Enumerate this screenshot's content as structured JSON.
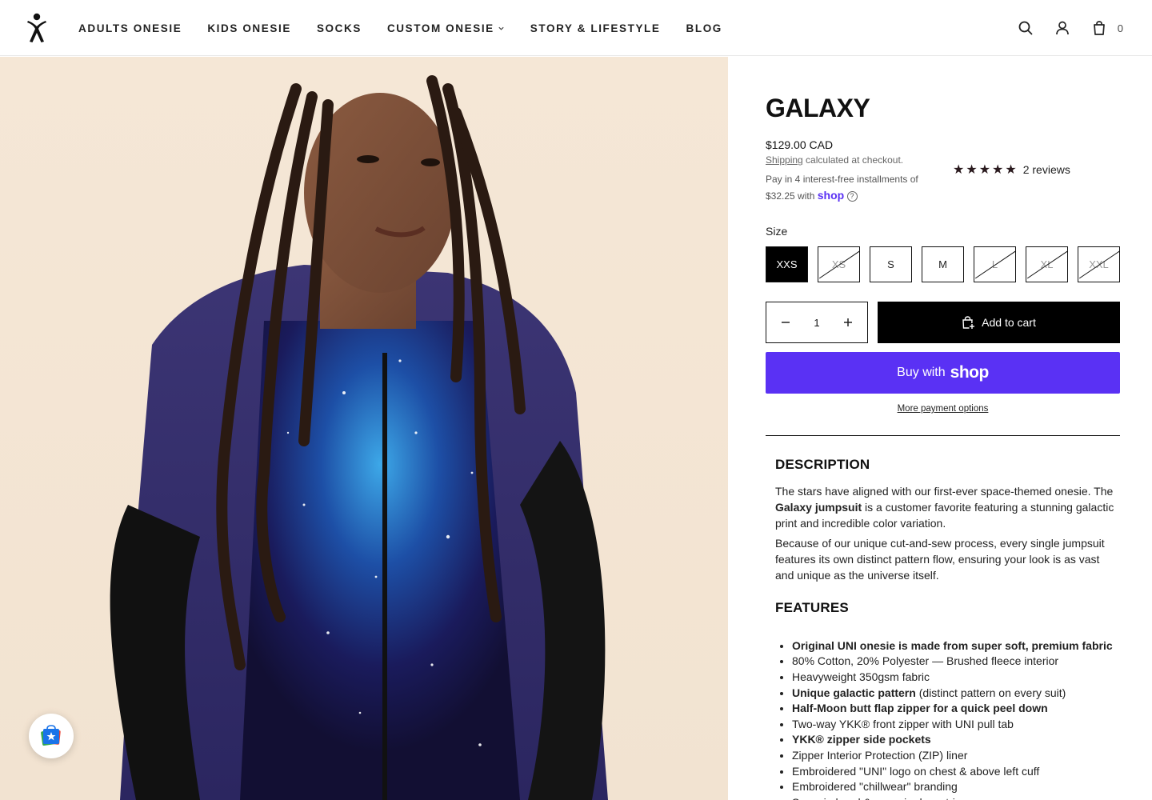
{
  "brand": {
    "logo_icon": "stick-figure-logo-icon"
  },
  "nav": {
    "items": [
      {
        "label": "ADULTS ONESIE"
      },
      {
        "label": "KIDS ONESIE"
      },
      {
        "label": "SOCKS"
      },
      {
        "label": "CUSTOM ONESIE",
        "has_dropdown": true
      },
      {
        "label": "STORY & LIFESTYLE"
      },
      {
        "label": "BLOG"
      }
    ]
  },
  "header": {
    "cart_count": "0",
    "icons": [
      "search-icon",
      "account-icon",
      "cart-icon"
    ]
  },
  "product": {
    "title": "GALAXY",
    "price": "$129.00 CAD",
    "shipping_link": "Shipping",
    "shipping_rest": " calculated at checkout.",
    "installments_text": "Pay in 4 interest-free installments of",
    "installments_amount": "$32.25",
    "installments_with": "with",
    "shop_word": "shop",
    "rating_stars": 5,
    "reviews_label": "2 reviews",
    "size_label": "Size",
    "sizes": [
      {
        "label": "XXS",
        "state": "selected"
      },
      {
        "label": "XS",
        "state": "soldout"
      },
      {
        "label": "S",
        "state": "available"
      },
      {
        "label": "M",
        "state": "available"
      },
      {
        "label": "L",
        "state": "soldout"
      },
      {
        "label": "XL",
        "state": "soldout"
      },
      {
        "label": "XXL",
        "state": "soldout"
      }
    ],
    "quantity": "1",
    "add_to_cart": "Add to cart",
    "buy_with": "Buy with",
    "buy_shop": "shop",
    "more_payment": "More payment options"
  },
  "description": {
    "title": "DESCRIPTION",
    "p1_a": "The stars have aligned with our first-ever space-themed onesie. The ",
    "p1_bold": "Galaxy jumpsuit",
    "p1_b": " is a customer favorite featuring a stunning galactic print and incredible color variation.",
    "p2": "Because of our unique cut-and-sew process, every single jumpsuit features its own distinct pattern flow, ensuring your look is as vast and unique as the universe itself.",
    "features_title": "FEATURES",
    "features": [
      {
        "bold": "Original UNI onesie is made from super soft, premium fabric",
        "rest": ""
      },
      {
        "bold": "",
        "rest": "80% Cotton, 20% Polyester — Brushed fleece interior"
      },
      {
        "bold": "",
        "rest": "Heavyweight 350gsm fabric"
      },
      {
        "bold": "Unique galactic pattern",
        "rest": " (distinct pattern on every suit)"
      },
      {
        "bold": "Half-Moon butt flap zipper for a quick peel down",
        "rest": ""
      },
      {
        "bold": "",
        "rest": "Two-way YKK® front zipper with UNI pull tab"
      },
      {
        "bold": "YKK® zipper side pockets",
        "rest": ""
      },
      {
        "bold": "",
        "rest": "Zipper Interior Protection (ZIP) liner"
      },
      {
        "bold": "",
        "rest": "Embroidered \"UNI\" logo on chest & above left cuff"
      },
      {
        "bold": "",
        "rest": "Embroidered \"chillwear\" branding"
      },
      {
        "bold": "",
        "rest": "Sewn-in hood & sewn-in drawstrings"
      }
    ]
  },
  "colors": {
    "shop_purple": "#5a31f4",
    "black": "#000000",
    "background_peach": "#f3e4d3"
  }
}
